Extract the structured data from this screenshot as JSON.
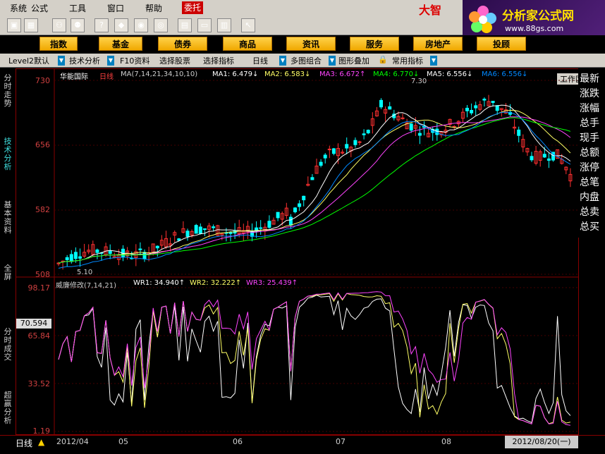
{
  "menu": {
    "items": [
      "系统",
      "公式",
      "工具",
      "窗口",
      "帮助"
    ],
    "trade": "委托",
    "brand": "大智"
  },
  "logo": {
    "title": "分析家公式网",
    "url": "www.88gs.com"
  },
  "categories": [
    "指数",
    "基金",
    "债券",
    "商品",
    "资讯",
    "服务",
    "房地产",
    "投顾"
  ],
  "workarea_label": "工作区",
  "tabs": [
    "Level2默认",
    "技术分析",
    "F10资料",
    "选择股票",
    "选择指标",
    "日线",
    "多图组合",
    "图形叠加",
    "常用指标"
  ],
  "left_tabs": [
    "分时走势",
    "技术分析",
    "基本资料",
    "全屏",
    "分时成交",
    "超赢分析"
  ],
  "right_panel": [
    "最新",
    "涨跌",
    "涨幅",
    "总手",
    "现手",
    "总额",
    "涨停",
    "总笔",
    "内盘",
    "总卖",
    "总买"
  ],
  "price_header": {
    "name": "华能国际",
    "period": "日线",
    "ma_def": "MA(7,14,21,34,10,10)",
    "ma1": "MA1: 6.479↓",
    "ma2": "MA2: 6.583↓",
    "ma3": "MA3: 6.672↑",
    "ma4": "MA4: 6.770↓",
    "ma5": "MA5: 6.556↓",
    "ma6": "MA6: 6.556↓",
    "high_mark": "7.30",
    "low_mark": "5.10"
  },
  "price_axis": [
    "730",
    "656",
    "582",
    "508"
  ],
  "indicator_header": {
    "name": "威廉修改(7,14,21)",
    "wr1": "WR1: 34.940↑",
    "wr2": "WR2: 32.222↑",
    "wr3": "WR3: 25.439↑"
  },
  "indicator_axis": [
    "98.17",
    "65.84",
    "33.52",
    "1.19"
  ],
  "cursor_value": "70.594",
  "period_label": "日线",
  "dates": [
    "2012/04",
    "05",
    "06",
    "07",
    "08"
  ],
  "cursor_date": "2012/08/20(一)",
  "colors": {
    "up": "#ff3030",
    "down": "#00ffff",
    "ma1": "#ffffff",
    "ma2": "#ffff66",
    "ma3": "#ff44ff",
    "ma4": "#00ff00",
    "ma5": "#ffffff",
    "ma6": "#0088ff"
  }
}
